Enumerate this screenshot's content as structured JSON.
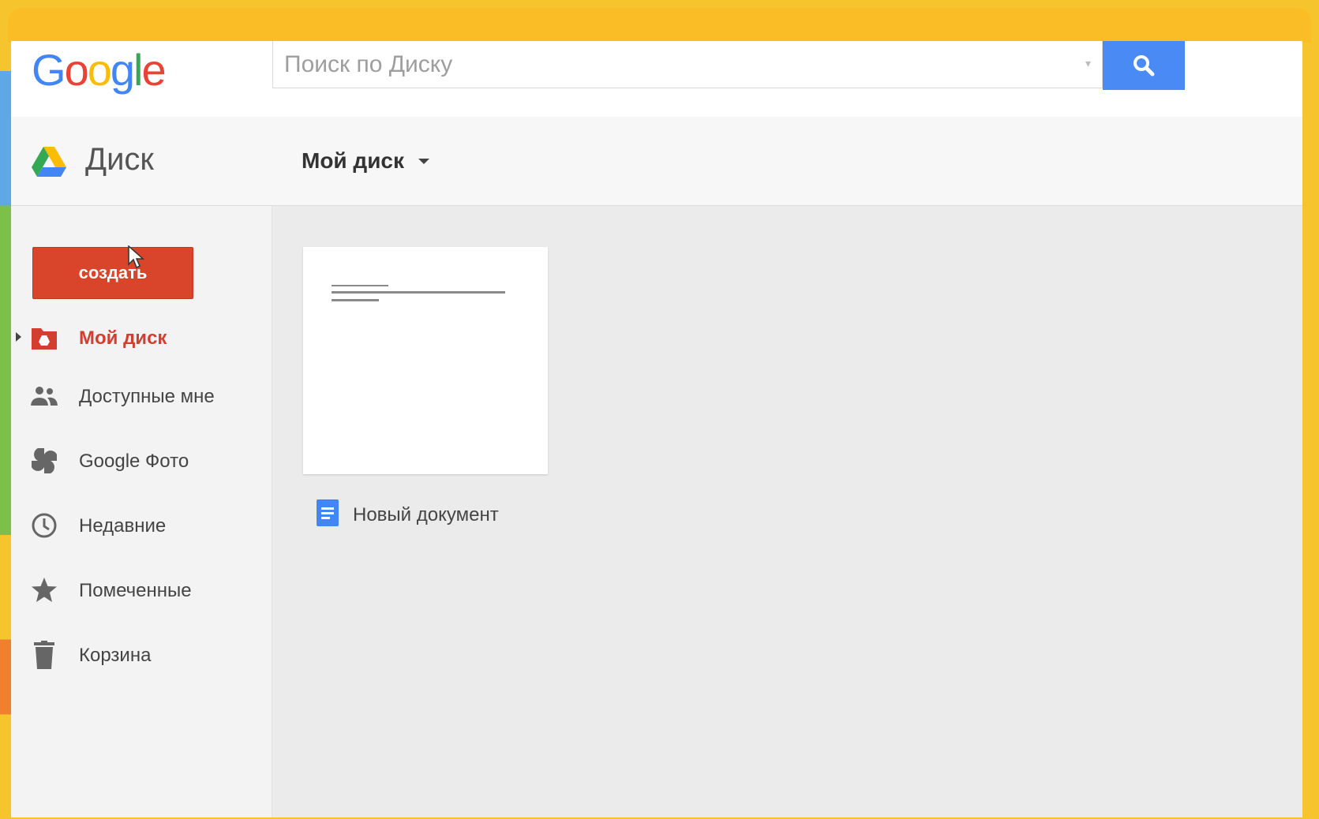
{
  "header": {
    "logo_letters": [
      "G",
      "o",
      "o",
      "g",
      "l",
      "e"
    ],
    "search": {
      "placeholder": "Поиск по Диску",
      "value": ""
    }
  },
  "drivebar": {
    "app_title": "Диск",
    "breadcrumb": "Мой диск"
  },
  "sidebar": {
    "create_label": "создать",
    "items": [
      {
        "label": "Мой диск",
        "icon": "my-drive-icon",
        "active": true
      },
      {
        "label": "Доступные мне",
        "icon": "shared-people-icon",
        "active": false
      },
      {
        "label": "Google Фото",
        "icon": "google-photos-icon",
        "active": false
      },
      {
        "label": "Недавние",
        "icon": "clock-icon",
        "active": false
      },
      {
        "label": "Помеченные",
        "icon": "star-icon",
        "active": false
      },
      {
        "label": "Корзина",
        "icon": "trash-icon",
        "active": false
      }
    ]
  },
  "files": [
    {
      "name": "Новый документ",
      "icon": "google-docs-icon"
    }
  ],
  "colors": {
    "create_button": "#d9452b",
    "search_button": "#4a8af4",
    "active_nav": "#d23f31",
    "frame": "#fbbd26"
  }
}
